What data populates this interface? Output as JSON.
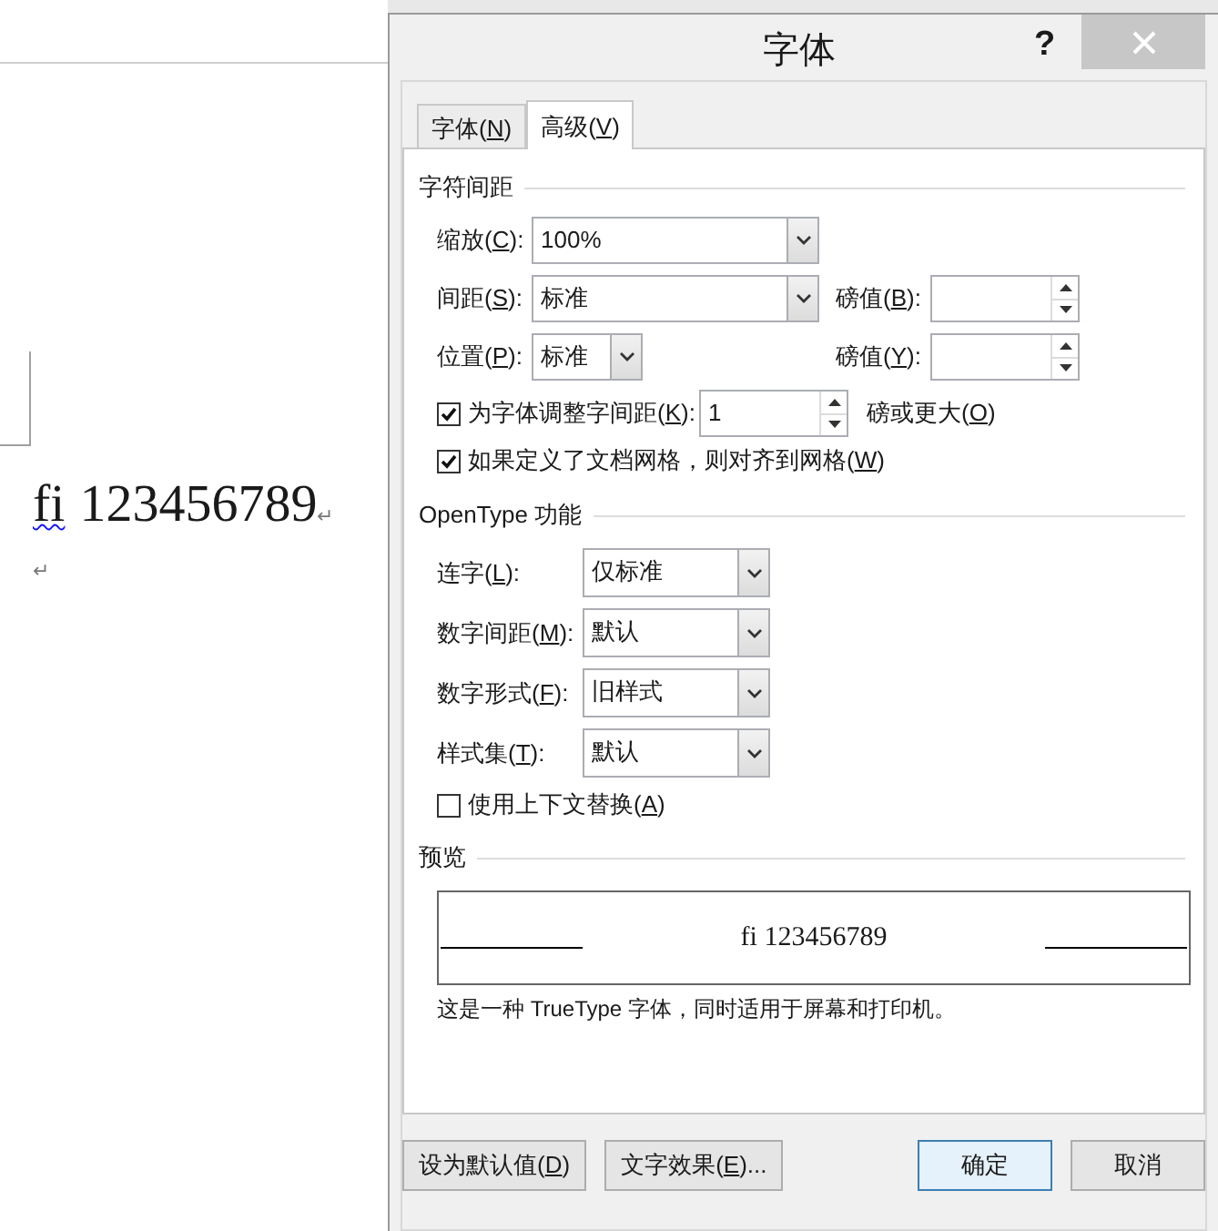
{
  "document": {
    "paragraphs": [
      {
        "runs": [
          {
            "text": "fi",
            "flagged": true
          },
          {
            "text": "123456789",
            "flagged": false
          }
        ],
        "mark": "↵"
      },
      {
        "mark": "↵"
      }
    ]
  },
  "dialog": {
    "title": "字体",
    "help": "?"
  },
  "tabs": [
    {
      "label": "字体(",
      "key": "N",
      "tail": ")",
      "selected": false
    },
    {
      "label": "高级(",
      "key": "V",
      "tail": ")",
      "selected": true
    }
  ],
  "spacing": {
    "title": "字符间距",
    "scale": {
      "label": "缩放(",
      "key": "C",
      "tail": "):",
      "value": "100%"
    },
    "spacing": {
      "label": "间距(",
      "key": "S",
      "tail": "):",
      "value": "标准",
      "points": {
        "label": "磅值(",
        "key": "B",
        "tail": "):"
      }
    },
    "position": {
      "label": "位置(",
      "key": "P",
      "tail": "):",
      "value": "标准",
      "points": {
        "label": "磅值(",
        "key": "Y",
        "tail": "):"
      }
    },
    "kerning": {
      "checked": true,
      "label": "为字体调整字间距(",
      "key": "K",
      "tail": "):",
      "value": "1",
      "unit": {
        "label": "磅或更大(",
        "key": "O",
        "tail": ")"
      }
    },
    "snap_grid": {
      "checked": true,
      "label": "如果定义了文档网格，则对齐到网格(",
      "key": "W",
      "tail": ")"
    }
  },
  "opentype": {
    "title": "OpenType 功能",
    "combos": [
      {
        "label": "连字(",
        "key": "L",
        "tail": "):",
        "value": "仅标准"
      },
      {
        "label": "数字间距(",
        "key": "M",
        "tail": "):",
        "value": "默认"
      },
      {
        "label": "数字形式(",
        "key": "F",
        "tail": "):",
        "value": "旧样式"
      },
      {
        "label": "样式集(",
        "key": "T",
        "tail": "):",
        "value": "默认"
      }
    ],
    "contextual": {
      "checked": false,
      "label": "使用上下文替换(",
      "key": "A",
      "tail": ")"
    }
  },
  "preview": {
    "title": "预览",
    "sample": "fi 123456789",
    "note": "这是一种 TrueType 字体，同时适用于屏幕和打印机。"
  },
  "buttons": [
    {
      "label": "设为默认值(",
      "key": "D",
      "tail": ")",
      "default": false
    },
    {
      "label": "文字效果(",
      "key": "E",
      "tail": ")...",
      "default": false
    },
    {
      "label": "确定",
      "default": true
    },
    {
      "label": "取消",
      "default": false
    }
  ]
}
